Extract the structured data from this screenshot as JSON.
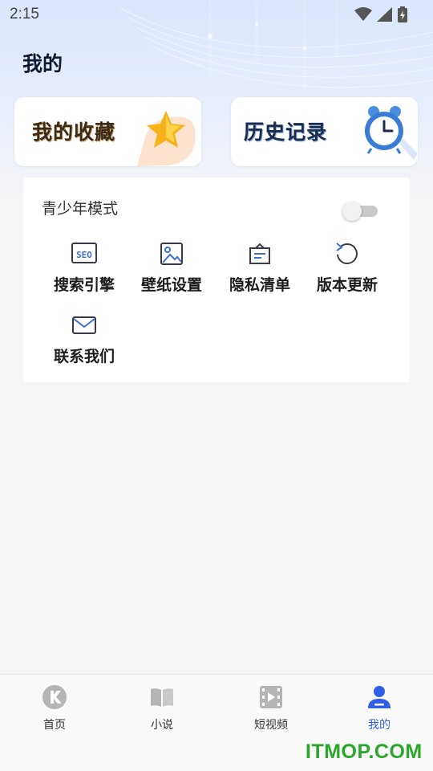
{
  "status_bar": {
    "time": "2:15"
  },
  "header": {
    "title": "我的"
  },
  "cards": {
    "favorites": {
      "label": "我的收藏",
      "icon": "star-icon"
    },
    "history": {
      "label": "历史记录",
      "icon": "alarm-clock-icon"
    }
  },
  "teen_mode": {
    "label": "青少年模式",
    "enabled": false
  },
  "grid": [
    {
      "label": "搜索引擎",
      "icon": "seo-icon"
    },
    {
      "label": "壁纸设置",
      "icon": "image-icon"
    },
    {
      "label": "隐私清单",
      "icon": "privacy-list-icon"
    },
    {
      "label": "版本更新",
      "icon": "refresh-icon"
    },
    {
      "label": "联系我们",
      "icon": "mail-icon"
    }
  ],
  "seo_text": "SEO",
  "bottom_nav": [
    {
      "label": "首页",
      "icon": "home-k-icon",
      "active": false
    },
    {
      "label": "小说",
      "icon": "book-icon",
      "active": false
    },
    {
      "label": "短视频",
      "icon": "video-icon",
      "active": false
    },
    {
      "label": "我的",
      "icon": "user-icon",
      "active": true
    }
  ],
  "colors": {
    "accent": "#2f5ee8",
    "icon_blue": "#3b6fd8",
    "icon_dark": "#3a3a4a",
    "inactive_nav": "#b5b5b5"
  },
  "watermark": "ITMOP.COM"
}
